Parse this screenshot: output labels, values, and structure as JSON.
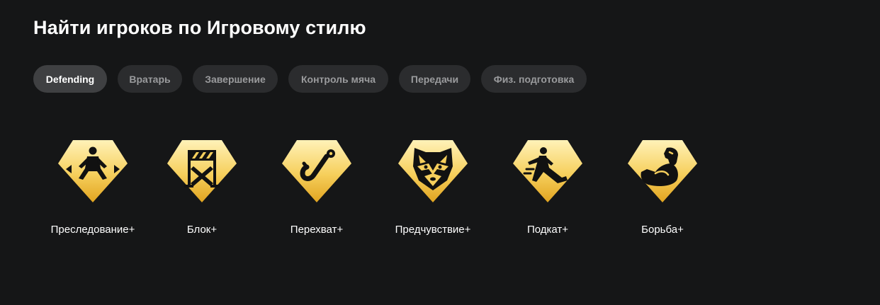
{
  "header": {
    "title": "Найти игроков по Игровому стилю"
  },
  "tabs": [
    {
      "label": "Defending",
      "active": true
    },
    {
      "label": "Вратарь",
      "active": false
    },
    {
      "label": "Завершение",
      "active": false
    },
    {
      "label": "Контроль мяча",
      "active": false
    },
    {
      "label": "Передачи",
      "active": false
    },
    {
      "label": "Физ. подготовка",
      "active": false
    }
  ],
  "playstyles": [
    {
      "label": "Преследование+",
      "icon": "jockey-icon"
    },
    {
      "label": "Блок+",
      "icon": "barrier-icon"
    },
    {
      "label": "Перехват+",
      "icon": "hook-icon"
    },
    {
      "label": "Предчувствие+",
      "icon": "raccoon-icon"
    },
    {
      "label": "Подкат+",
      "icon": "slide-tackle-icon"
    },
    {
      "label": "Борьба+",
      "icon": "flexed-arm-icon"
    }
  ],
  "colors": {
    "background": "#151617",
    "badge_light": "#fff2b8",
    "badge_dark": "#e1a420",
    "tab_bg": "#2b2c2e",
    "tab_active_bg": "#3f4042"
  }
}
